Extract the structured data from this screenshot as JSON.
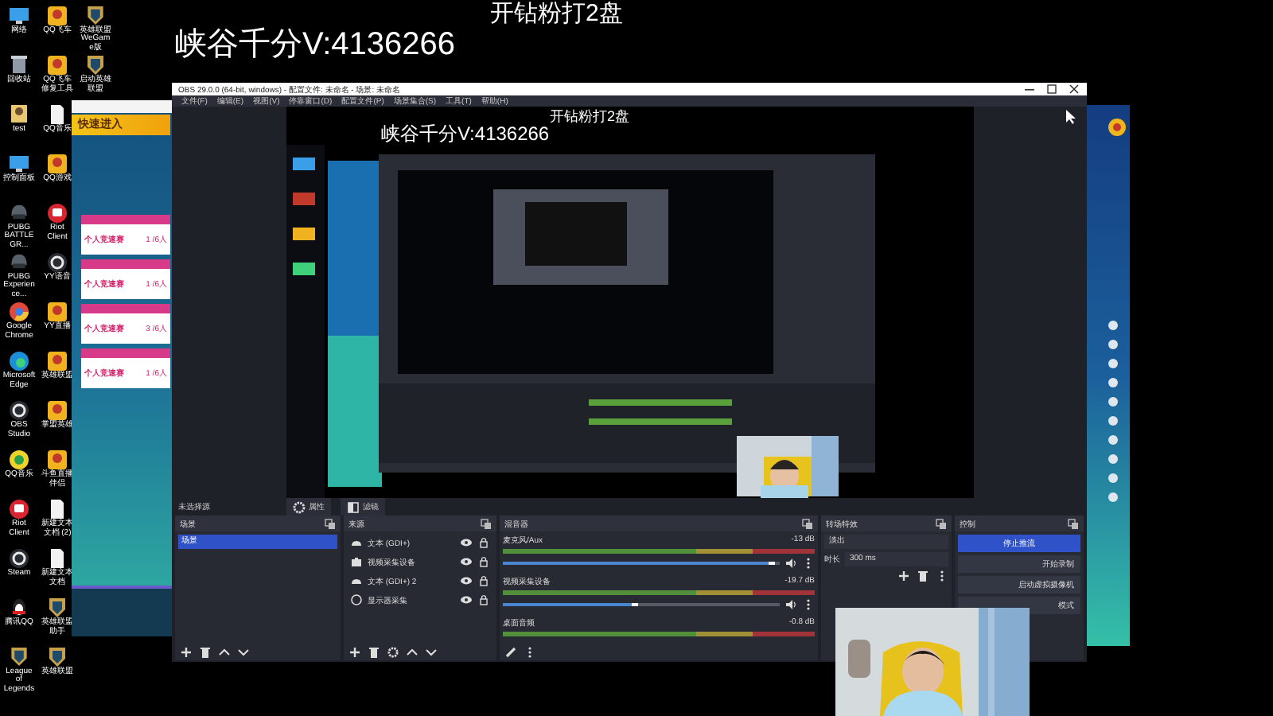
{
  "overlay_texts": [
    "开钻粉打2盘",
    "峡谷千分V:4136266"
  ],
  "desktop_columns": [
    [
      {
        "label": "网络",
        "kind": "monitor"
      },
      {
        "label": "回收站",
        "kind": "bin"
      },
      {
        "label": "test",
        "kind": "person"
      },
      {
        "label": "控制面板",
        "kind": "monitor"
      },
      {
        "label": "PUBG BATTLEGR...",
        "kind": "helmet"
      },
      {
        "label": "PUBG Experience...",
        "kind": "helmet"
      },
      {
        "label": "Google Chrome",
        "kind": "browser"
      },
      {
        "label": "Microsoft Edge",
        "kind": "wave"
      },
      {
        "label": "OBS Studio",
        "kind": "ring"
      },
      {
        "label": "QQ音乐",
        "kind": "note"
      },
      {
        "label": "Riot Client",
        "kind": "fist"
      },
      {
        "label": "Steam",
        "kind": "ring"
      },
      {
        "label": "腾讯QQ",
        "kind": "penguin"
      },
      {
        "label": "League of Legends",
        "kind": "shield"
      }
    ],
    [
      {
        "label": "QQ飞车",
        "kind": "game"
      },
      {
        "label": "QQ飞车修复工具",
        "kind": "game"
      },
      {
        "label": "QQ音乐",
        "kind": "document"
      },
      {
        "label": "QQ游戏",
        "kind": "game"
      },
      {
        "label": "Riot Client",
        "kind": "fist"
      },
      {
        "label": "YY语音",
        "kind": "ring"
      },
      {
        "label": "YY直播",
        "kind": "game"
      },
      {
        "label": "英雄联盟",
        "kind": "game"
      },
      {
        "label": "掌盟英雄",
        "kind": "game"
      },
      {
        "label": "斗鱼直播伴侣",
        "kind": "game"
      },
      {
        "label": "新建文本文档 (2)",
        "kind": "document"
      },
      {
        "label": "新建文本文档",
        "kind": "document"
      },
      {
        "label": "英雄联盟助手",
        "kind": "shield"
      },
      {
        "label": "英雄联盟",
        "kind": "shield"
      }
    ],
    [
      {
        "label": "英雄联盟WeGame版",
        "kind": "shield"
      },
      {
        "label": "启动英雄联盟",
        "kind": "shield"
      }
    ]
  ],
  "game_window": {
    "button": "快速进入",
    "cards": [
      {
        "title": "个人竞速赛",
        "count": "1 /6人"
      },
      {
        "title": "个人竞速赛",
        "count": "1 /6人"
      },
      {
        "title": "个人竞速赛",
        "count": "3 /6人"
      },
      {
        "title": "个人竞速赛",
        "count": "1 /6人"
      }
    ]
  },
  "obs": {
    "title": "OBS 29.0.0 (64-bit, windows) - 配置文件: 未命名 - 场景: 未命名",
    "menu": [
      "文件(F)",
      "编辑(E)",
      "视图(V)",
      "停靠窗口(D)",
      "配置文件(P)",
      "场景集合(S)",
      "工具(T)",
      "帮助(H)"
    ],
    "preview_texts": [
      "开钻粉打2盘",
      "峡谷千分V:4136266"
    ],
    "source_bar": {
      "label": "未选择源",
      "buttons": [
        {
          "label": "属性",
          "kind": "gear"
        },
        {
          "label": "滤镜",
          "kind": "filter"
        }
      ]
    },
    "scenes": {
      "title": "场景",
      "items": [
        {
          "label": "场景",
          "selected": true
        }
      ]
    },
    "sources": {
      "title": "来源",
      "items": [
        {
          "label": "文本 (GDI+)",
          "kind": "text"
        },
        {
          "label": "视频采集设备",
          "kind": "camera"
        },
        {
          "label": "文本 (GDI+) 2",
          "kind": "text"
        },
        {
          "label": "显示器采集",
          "kind": "display"
        }
      ]
    },
    "mixer": {
      "title": "混音器",
      "channels": [
        {
          "name": "麦克风/Aux",
          "reading": "-13 dB",
          "level": 0.98
        },
        {
          "name": "视频采集设备",
          "reading": "-19.7 dB",
          "level": 0.49
        },
        {
          "name": "桌面音频",
          "reading": "-0.8 dB"
        }
      ]
    },
    "transitions": {
      "title": "转场特效",
      "value": "淡出",
      "duration_label": "时长",
      "duration": "300 ms"
    },
    "controls": {
      "title": "控制",
      "buttons": [
        {
          "label": "停止推流",
          "active": true
        },
        {
          "label": "开始录制",
          "active": false
        },
        {
          "label": "启动虚拟摄像机",
          "active": false
        },
        {
          "label": "模式",
          "active": false
        }
      ]
    }
  }
}
